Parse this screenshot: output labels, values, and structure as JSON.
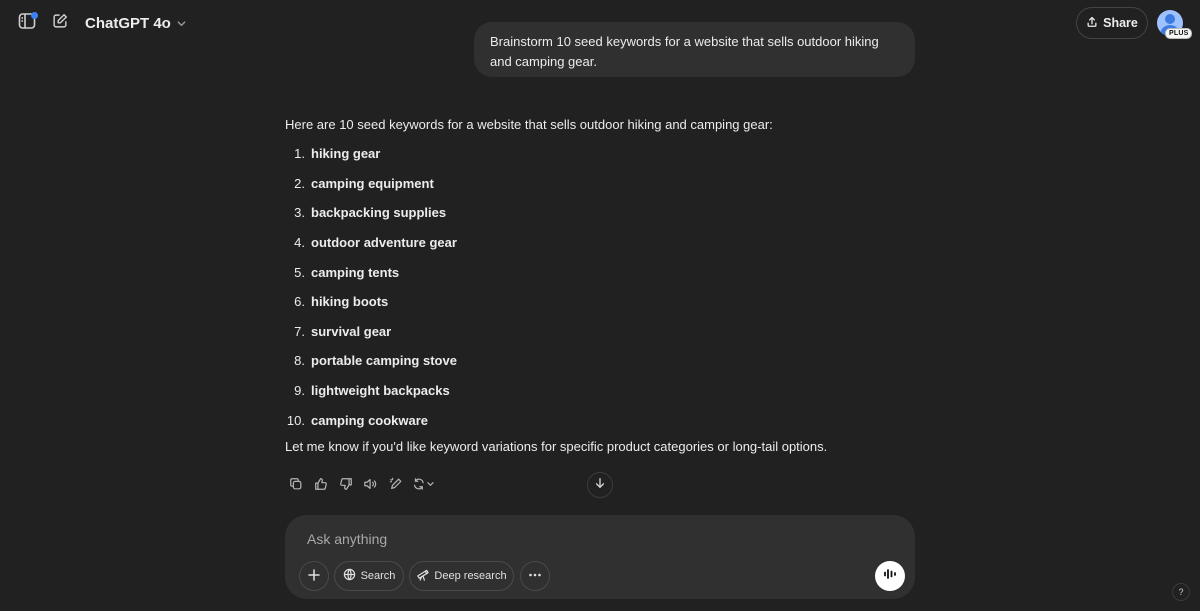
{
  "header": {
    "model_name": "ChatGPT 4o",
    "share_label": "Share",
    "plan_badge": "PLUS",
    "icons": [
      "sidebar-toggle-icon",
      "new-chat-icon",
      "chevron-down-icon",
      "share-icon",
      "avatar"
    ],
    "notification_dot_color": "#3b82f6"
  },
  "conversation": {
    "user_message": "Brainstorm 10 seed keywords for a website that sells outdoor hiking and camping gear.",
    "assistant": {
      "intro": "Here are 10 seed keywords for a website that sells outdoor hiking and camping gear:",
      "keywords": [
        {
          "num": "1.",
          "text": "hiking gear"
        },
        {
          "num": "2.",
          "text": "camping equipment"
        },
        {
          "num": "3.",
          "text": "backpacking supplies"
        },
        {
          "num": "4.",
          "text": "outdoor adventure gear"
        },
        {
          "num": "5.",
          "text": "camping tents"
        },
        {
          "num": "6.",
          "text": "hiking boots"
        },
        {
          "num": "7.",
          "text": "survival gear"
        },
        {
          "num": "8.",
          "text": "portable camping stove"
        },
        {
          "num": "9.",
          "text": "lightweight backpacks"
        },
        {
          "num": "10.",
          "text": "camping cookware"
        }
      ],
      "outro": "Let me know if you'd like keyword variations for specific product categories or long-tail options.",
      "action_icons": [
        "copy-icon",
        "thumbs-up-icon",
        "thumbs-down-icon",
        "read-aloud-icon",
        "edit-in-canvas-icon",
        "regenerate-icon"
      ]
    }
  },
  "composer": {
    "placeholder": "Ask anything",
    "search_label": "Search",
    "deep_research_label": "Deep research",
    "help_label": "?"
  },
  "colors": {
    "background": "#212121",
    "bubble": "#303030",
    "text": "#ececec"
  }
}
